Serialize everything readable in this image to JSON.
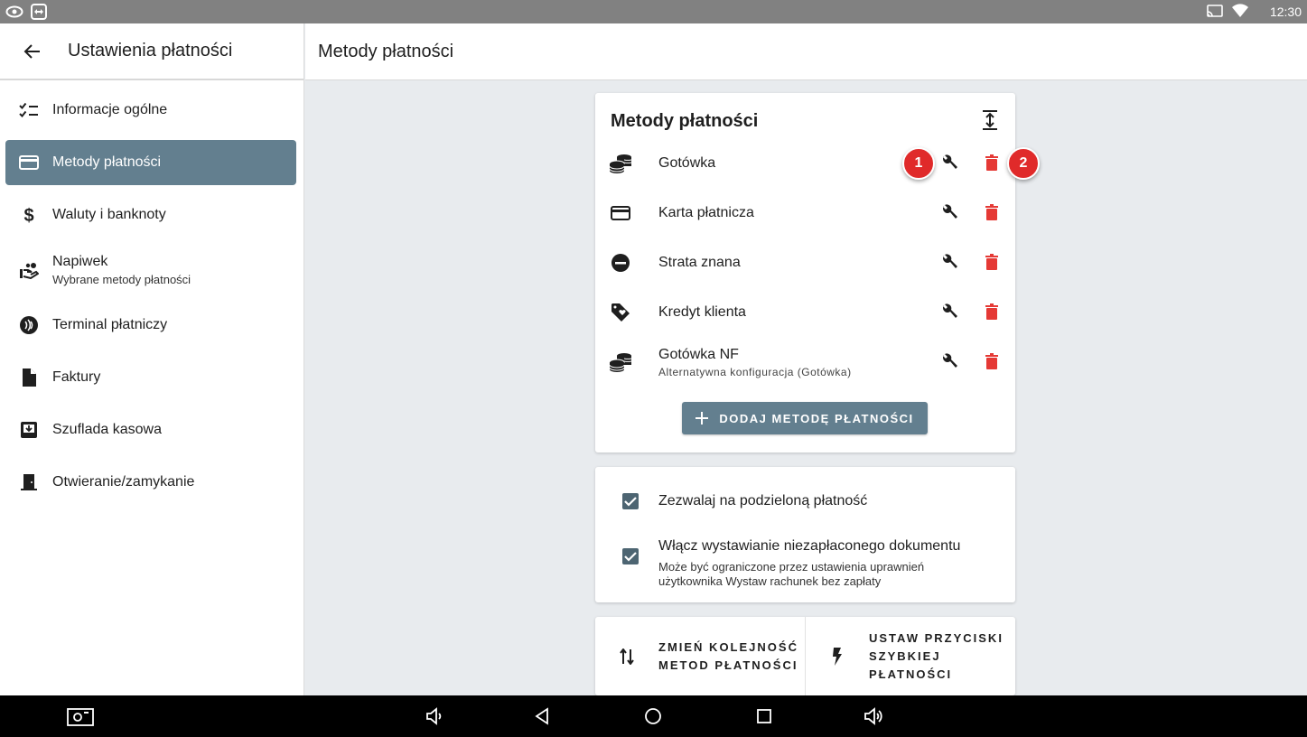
{
  "status_bar": {
    "time": "12:30",
    "left_icons": [
      "eye-icon",
      "teamviewer-icon"
    ],
    "right_icons": [
      "cast-icon",
      "wifi-icon"
    ]
  },
  "sidebar": {
    "title": "Ustawienia płatności",
    "items": [
      {
        "label": "Informacje ogólne",
        "icon": "checklist-icon"
      },
      {
        "label": "Metody płatności",
        "icon": "credit-card-icon",
        "active": true
      },
      {
        "label": "Waluty i banknoty",
        "icon": "dollar-icon"
      },
      {
        "label": "Napiwek",
        "sublabel": "Wybrane metody płatności",
        "icon": "tip-hand-icon"
      },
      {
        "label": "Terminal płatniczy",
        "icon": "contactless-icon"
      },
      {
        "label": "Faktury",
        "icon": "document-icon"
      },
      {
        "label": "Szuflada kasowa",
        "icon": "drawer-icon"
      },
      {
        "label": "Otwieranie/zamykanie",
        "icon": "door-icon"
      }
    ]
  },
  "header": {
    "title": "Metody płatności"
  },
  "methods_card": {
    "title": "Metody płatności",
    "methods": [
      {
        "name": "Gotówka",
        "sub": "",
        "icon": "coins-icon"
      },
      {
        "name": "Karta płatnicza",
        "sub": "",
        "icon": "credit-card-icon"
      },
      {
        "name": "Strata znana",
        "sub": "",
        "icon": "minus-circle-icon"
      },
      {
        "name": "Kredyt klienta",
        "sub": "",
        "icon": "tag-heart-icon"
      },
      {
        "name": "Gotówka NF",
        "sub": "Alternatywna konfiguracja (Gotówka)",
        "icon": "coins-icon"
      }
    ],
    "badges": [
      "1",
      "2"
    ],
    "add_button": "DODAJ METODĘ PŁATNOŚCI"
  },
  "options_card": {
    "split_payment": {
      "label": "Zezwalaj na podzieloną płatność",
      "checked": true
    },
    "unpaid_document": {
      "label": "Włącz wystawianie niezapłaconego dokumentu",
      "sub_line1": "Może być ograniczone przez ustawienia uprawnień",
      "sub_line2": "użytkownika Wystaw rachunek bez zapłaty",
      "checked": true
    }
  },
  "actions_card": {
    "reorder": {
      "line1": "ZMIEŃ KOLEJNOŚĆ",
      "line2": "METOD PŁATNOŚCI"
    },
    "quick_pay": {
      "line1": "USTAW PRZYCISKI",
      "line2": "SZYBKIEJ",
      "line3": "PŁATNOŚCI"
    }
  },
  "colors": {
    "accent": "#637f8f",
    "delete": "#e53935",
    "badge": "#e02a2a",
    "checkbox": "#4d6572"
  }
}
